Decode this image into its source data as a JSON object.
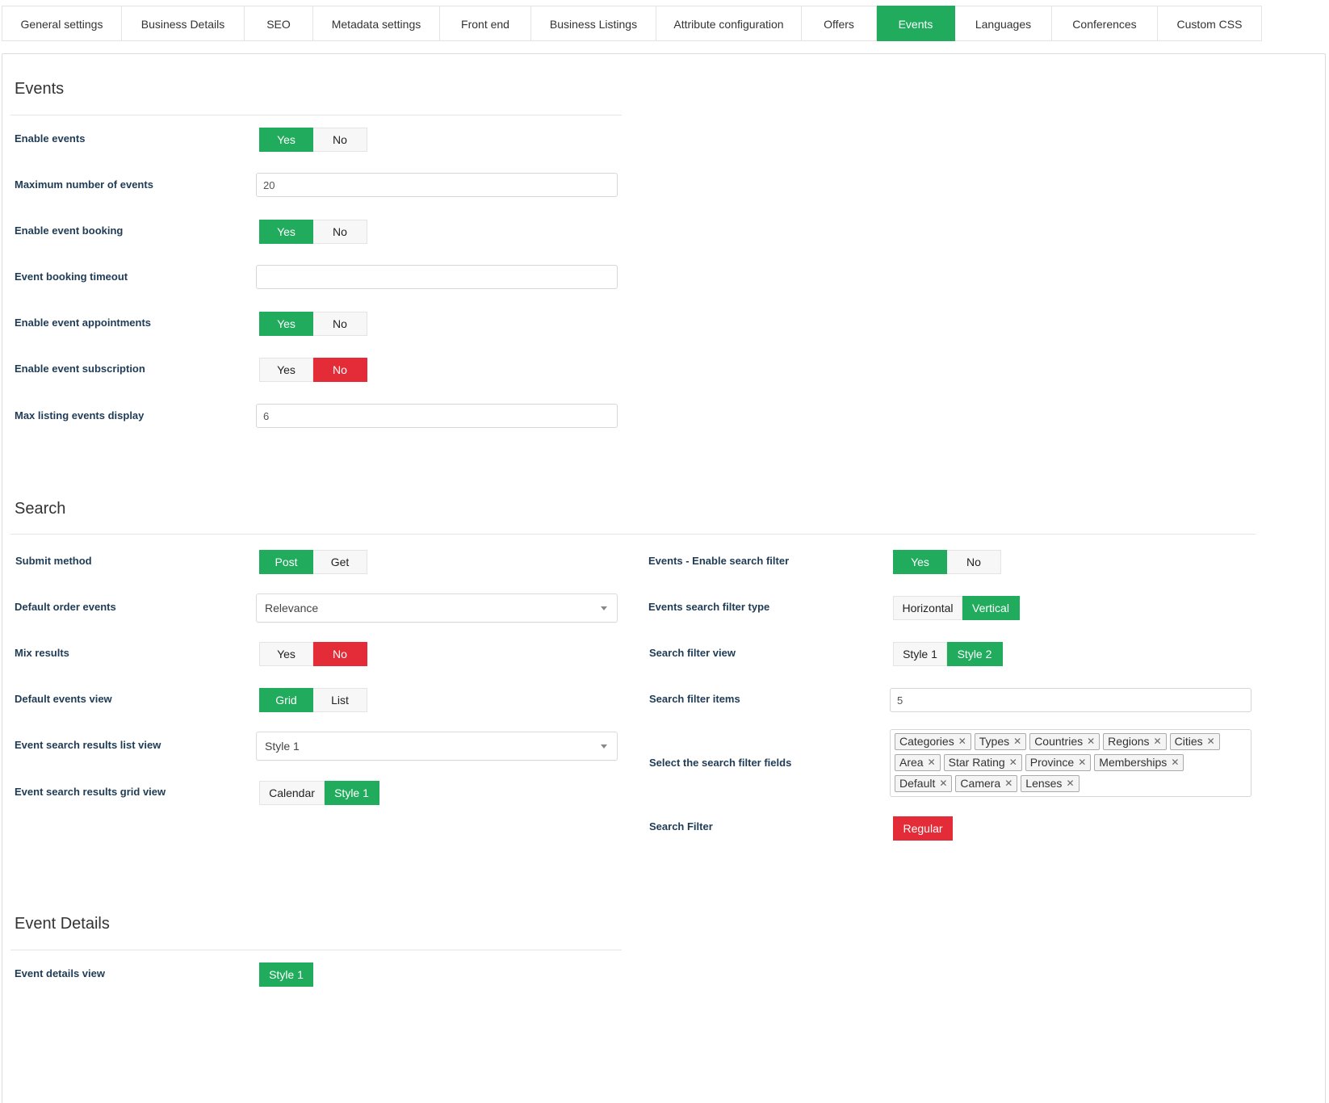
{
  "tabs": [
    {
      "label": "General settings",
      "active": false
    },
    {
      "label": "Business Details",
      "active": false
    },
    {
      "label": "SEO",
      "active": false
    },
    {
      "label": "Metadata settings",
      "active": false
    },
    {
      "label": "Front end",
      "active": false
    },
    {
      "label": "Business Listings",
      "active": false
    },
    {
      "label": "Attribute configuration",
      "active": false
    },
    {
      "label": "Offers",
      "active": false
    },
    {
      "label": "Events",
      "active": true
    },
    {
      "label": "Languages",
      "active": false
    },
    {
      "label": "Conferences",
      "active": false
    },
    {
      "label": "Custom CSS",
      "active": false
    }
  ],
  "colors": {
    "accent_green": "#21ab5d",
    "accent_red": "#e32c37",
    "label_color": "#1f3b55"
  },
  "events": {
    "title": "Events",
    "enable_events": {
      "label": "Enable events",
      "options": [
        "Yes",
        "No"
      ],
      "selected": "Yes"
    },
    "max_events": {
      "label": "Maximum number of events",
      "value": "20"
    },
    "enable_booking": {
      "label": "Enable event booking",
      "options": [
        "Yes",
        "No"
      ],
      "selected": "Yes"
    },
    "booking_timeout": {
      "label": "Event booking timeout",
      "value": ""
    },
    "enable_appointments": {
      "label": "Enable event appointments",
      "options": [
        "Yes",
        "No"
      ],
      "selected": "Yes"
    },
    "enable_subscription": {
      "label": "Enable event subscription",
      "options": [
        "Yes",
        "No"
      ],
      "selected": "No"
    },
    "max_listing_display": {
      "label": "Max listing events display",
      "value": "6"
    }
  },
  "search": {
    "title": "Search",
    "submit_method": {
      "label": "Submit method",
      "options": [
        "Post",
        "Get"
      ],
      "selected": "Post"
    },
    "default_order": {
      "label": "Default order events",
      "value": "Relevance"
    },
    "mix_results": {
      "label": "Mix results",
      "options": [
        "Yes",
        "No"
      ],
      "selected": "No"
    },
    "default_view": {
      "label": "Default events view",
      "options": [
        "Grid",
        "List"
      ],
      "selected": "Grid"
    },
    "results_list_view": {
      "label": "Event search results list view",
      "value": "Style 1"
    },
    "results_grid_view": {
      "label": "Event search results grid view",
      "options": [
        "Calendar",
        "Style 1"
      ],
      "selected": "Style 1"
    },
    "enable_search_filter": {
      "label": "Events - Enable search filter",
      "options": [
        "Yes",
        "No"
      ],
      "selected": "Yes"
    },
    "filter_type": {
      "label": "Events search filter type",
      "options": [
        "Horizontal",
        "Vertical"
      ],
      "selected": "Vertical"
    },
    "filter_view": {
      "label": "Search filter view",
      "options": [
        "Style 1",
        "Style 2"
      ],
      "selected": "Style 2"
    },
    "filter_items": {
      "label": "Search filter items",
      "value": "5"
    },
    "filter_fields": {
      "label": "Select the search filter fields",
      "tags": [
        "Categories",
        "Types",
        "Countries",
        "Regions",
        "Cities",
        "Area",
        "Star Rating",
        "Province",
        "Memberships",
        "Default",
        "Camera",
        "Lenses"
      ]
    },
    "search_filter": {
      "label": "Search Filter",
      "options": [
        "Regular"
      ],
      "selected": "Regular"
    }
  },
  "details": {
    "title": "Event Details",
    "details_view": {
      "label": "Event details view",
      "options": [
        "Style 1"
      ],
      "selected": "Style 1"
    }
  }
}
